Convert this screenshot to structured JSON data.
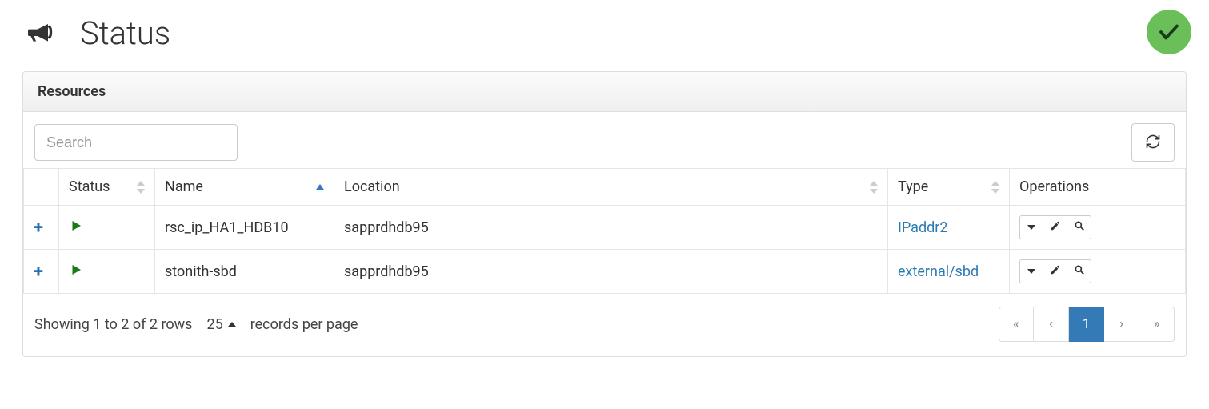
{
  "header": {
    "title": "Status",
    "health": "ok"
  },
  "panel": {
    "title": "Resources"
  },
  "search": {
    "placeholder": "Search",
    "value": ""
  },
  "columns": {
    "status": "Status",
    "name": "Name",
    "location": "Location",
    "type": "Type",
    "operations": "Operations"
  },
  "sort": {
    "column": "name",
    "dir": "asc"
  },
  "rows": [
    {
      "status": "running",
      "name": "rsc_ip_HA1_HDB10",
      "location": "sapprdhdb95",
      "type": "IPaddr2"
    },
    {
      "status": "running",
      "name": "stonith-sbd",
      "location": "sapprdhdb95",
      "type": "external/sbd"
    }
  ],
  "footer": {
    "summary": "Showing 1 to 2 of 2 rows",
    "page_size": "25",
    "records_per_page": "records per page"
  },
  "pagination": {
    "first": "«",
    "prev": "‹",
    "pages": [
      "1"
    ],
    "active": "1",
    "next": "›",
    "last": "»"
  }
}
